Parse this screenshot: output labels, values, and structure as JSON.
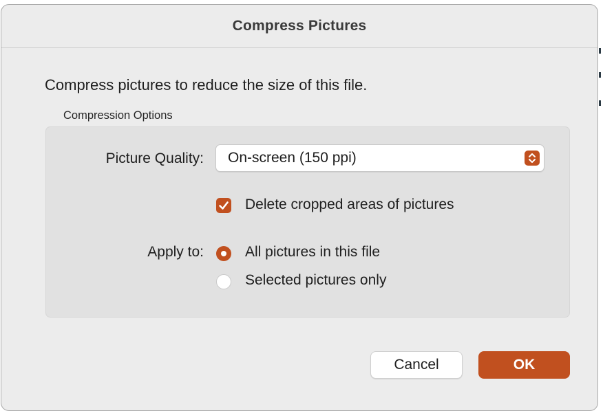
{
  "dialog": {
    "title": "Compress Pictures",
    "description": "Compress pictures to reduce the size of this file.",
    "group_label": "Compression Options"
  },
  "picture_quality": {
    "label": "Picture Quality:",
    "selected": "On-screen (150 ppi)"
  },
  "delete_cropped": {
    "label": "Delete cropped areas of pictures",
    "checked": true
  },
  "apply_to": {
    "label": "Apply to:",
    "options": [
      {
        "label": "All pictures in this file",
        "selected": true
      },
      {
        "label": "Selected pictures only",
        "selected": false
      }
    ]
  },
  "buttons": {
    "cancel": "Cancel",
    "ok": "OK"
  },
  "colors": {
    "accent": "#c1501f",
    "dialog_bg": "#ececec",
    "group_bg": "#e1e1e1"
  },
  "icons": {
    "select_stepper": "chevron-up-down-icon",
    "checkbox": "checkmark-icon"
  }
}
